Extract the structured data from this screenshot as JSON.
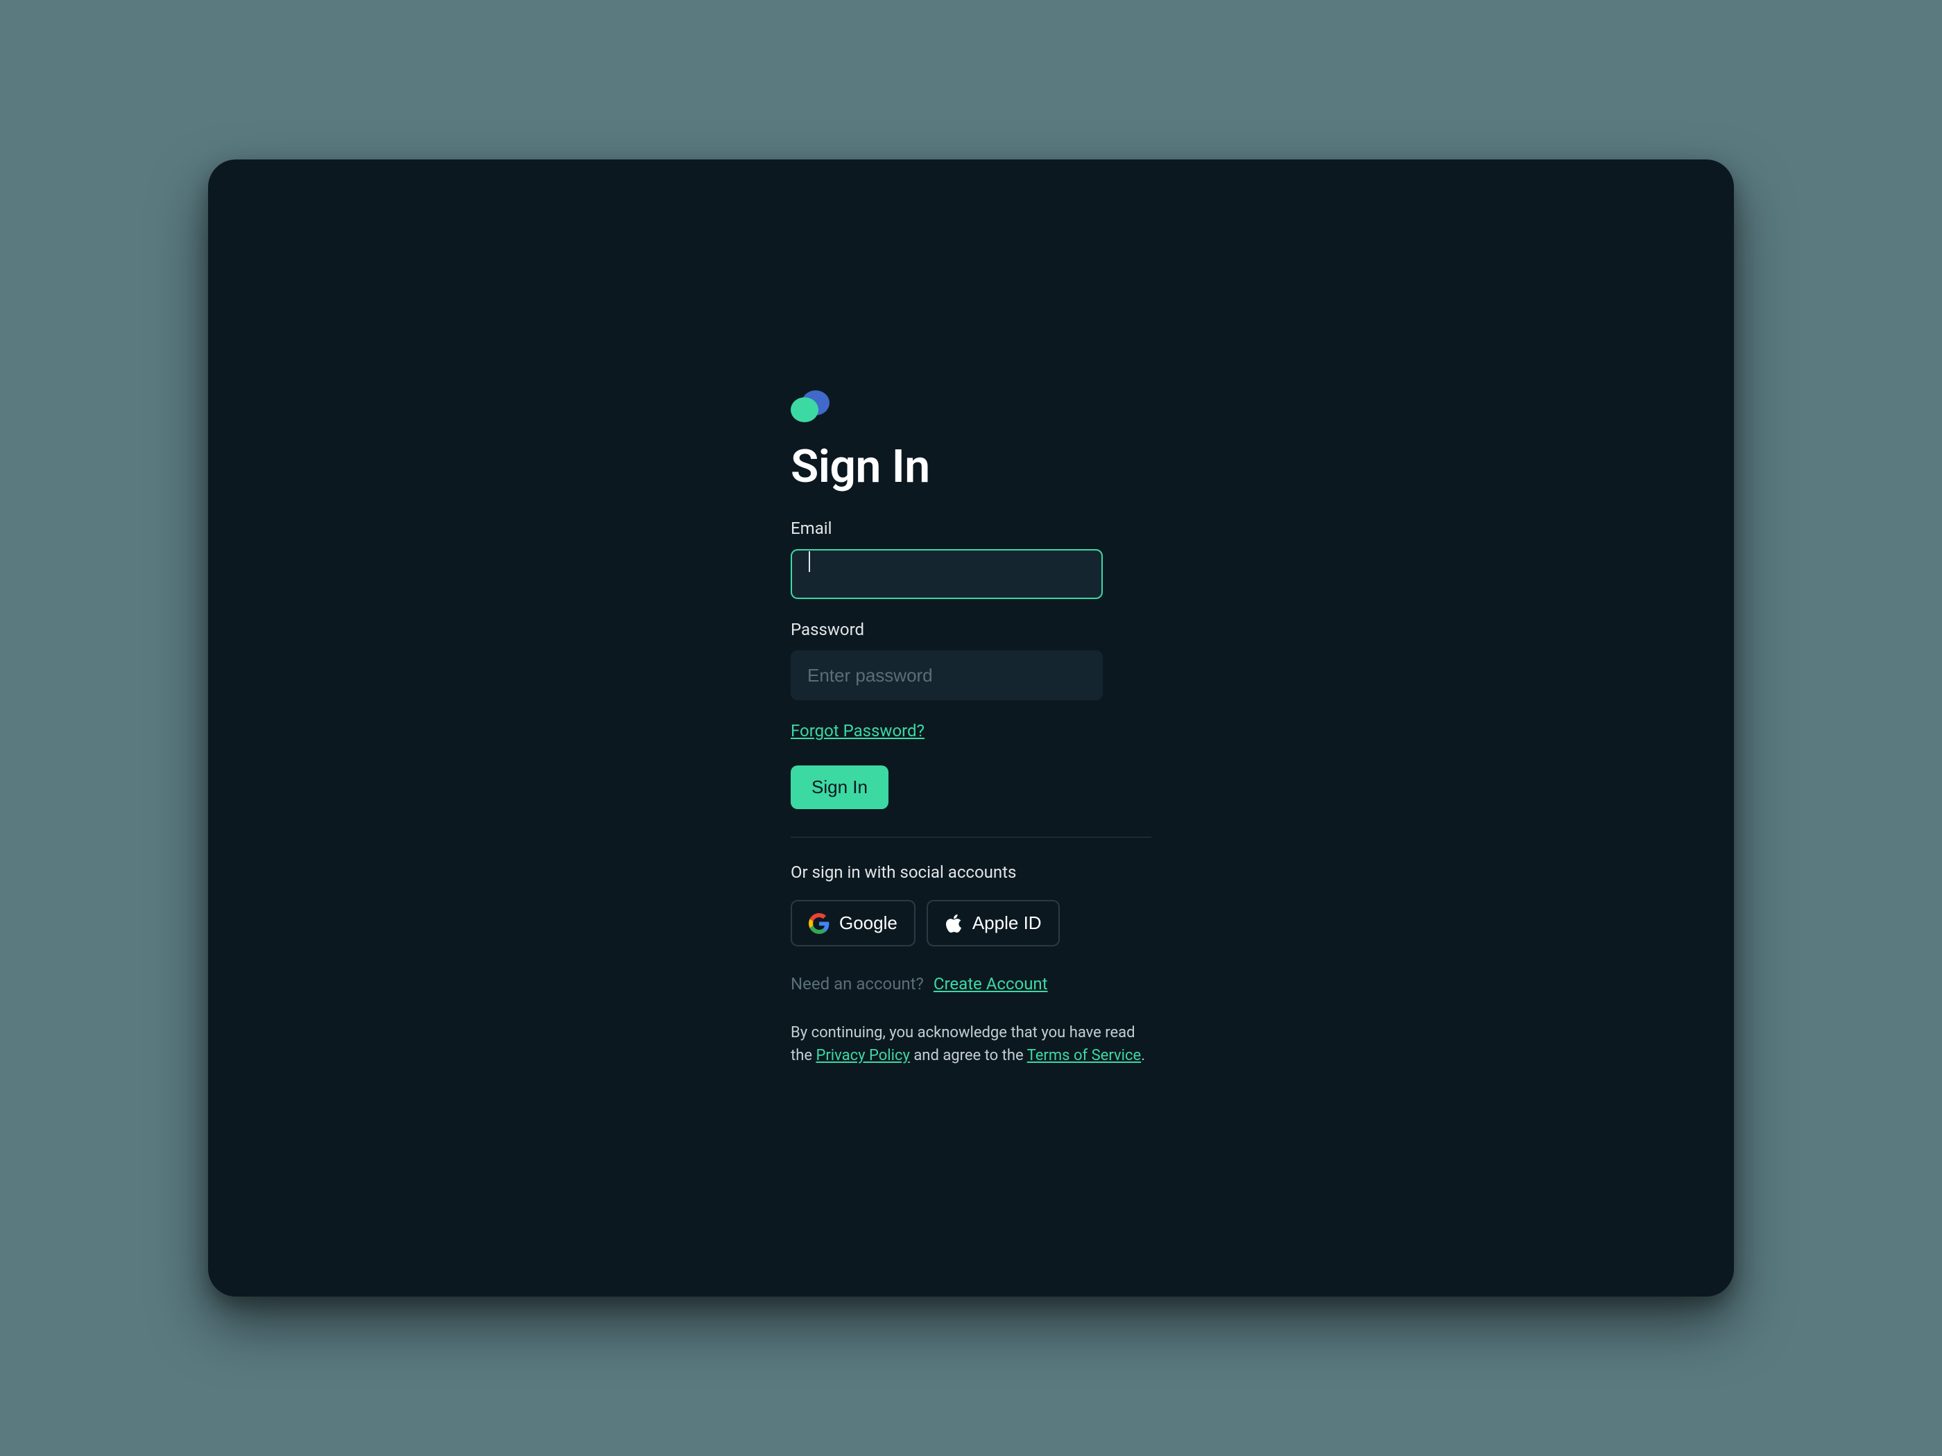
{
  "page": {
    "title": "Sign In"
  },
  "form": {
    "email_label": "Email",
    "email_value": "",
    "email_placeholder": "",
    "password_label": "Password",
    "password_value": "",
    "password_placeholder": "Enter password",
    "forgot_link": "Forgot Password?",
    "submit_label": "Sign In"
  },
  "social": {
    "label": "Or sign in with social accounts",
    "google_label": "Google",
    "apple_label": "Apple ID"
  },
  "footer": {
    "need_account": "Need an account?",
    "create_link": "Create Account"
  },
  "legal": {
    "pre": "By continuing, you acknowledge that you have read the ",
    "privacy": "Privacy Policy",
    "mid": " and agree to the ",
    "terms": "Terms of Service",
    "post": "."
  },
  "colors": {
    "background_page": "#5a7a80",
    "background_panel": "#0c1820",
    "accent": "#3cd9a3",
    "logo_blue": "#4069c9",
    "input_bg": "#152530"
  }
}
